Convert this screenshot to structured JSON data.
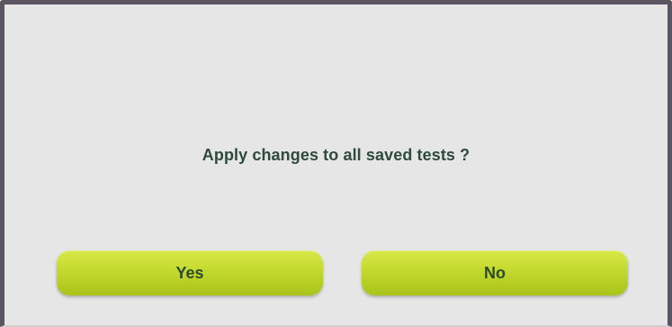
{
  "dialog": {
    "message": "Apply changes to all saved tests ?",
    "yes_label": "Yes",
    "no_label": "No"
  },
  "colors": {
    "background": "#e6e6e6",
    "frame": "#5a5560",
    "button": "#c3d92e",
    "text": "#2e4a3a"
  }
}
